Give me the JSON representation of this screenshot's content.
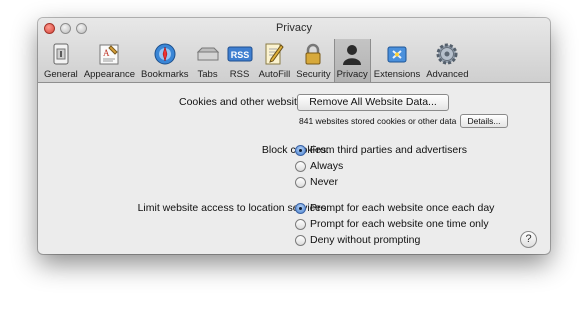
{
  "window": {
    "title": "Privacy"
  },
  "toolbar": {
    "tabs": [
      {
        "label": "General",
        "icon": "general-icon"
      },
      {
        "label": "Appearance",
        "icon": "appearance-icon"
      },
      {
        "label": "Bookmarks",
        "icon": "bookmarks-icon"
      },
      {
        "label": "Tabs",
        "icon": "tabs-icon"
      },
      {
        "label": "RSS",
        "icon": "rss-icon",
        "icon_text": "RSS"
      },
      {
        "label": "AutoFill",
        "icon": "autofill-icon"
      },
      {
        "label": "Security",
        "icon": "lock-icon"
      },
      {
        "label": "Privacy",
        "icon": "privacy-icon",
        "selected": true
      },
      {
        "label": "Extensions",
        "icon": "extensions-icon"
      },
      {
        "label": "Advanced",
        "icon": "advanced-gear-icon"
      }
    ]
  },
  "privacy": {
    "cookies_label": "Cookies and other website data:",
    "remove_all_button": "Remove All Website Data...",
    "stored_info": "841 websites stored cookies or other data",
    "details_button": "Details...",
    "block_cookies_label": "Block cookies:",
    "block_options": [
      {
        "label": "From third parties and advertisers",
        "selected": true
      },
      {
        "label": "Always",
        "selected": false
      },
      {
        "label": "Never",
        "selected": false
      }
    ],
    "location_label": "Limit website access to location services:",
    "location_options": [
      {
        "label": "Prompt for each website once each day",
        "selected": true
      },
      {
        "label": "Prompt for each website one time only",
        "selected": false
      },
      {
        "label": "Deny without prompting",
        "selected": false
      }
    ],
    "help_button": "?"
  },
  "colors": {
    "accent": "#4c85d2",
    "window_bg": "#ececec",
    "close_button": "#d5463b"
  }
}
